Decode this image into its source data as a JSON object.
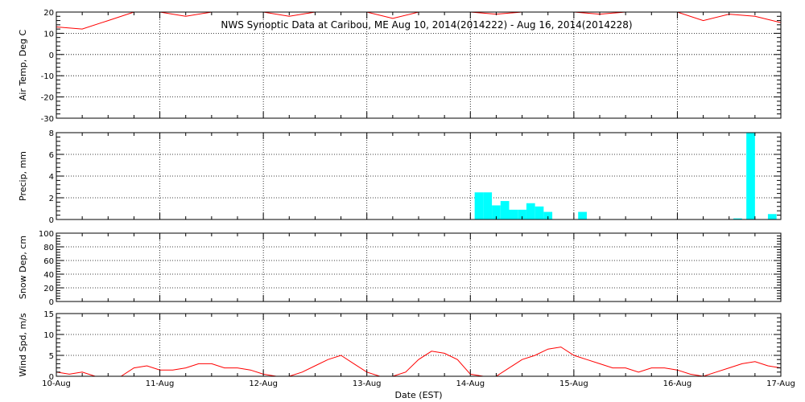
{
  "chart_data": [
    {
      "panel": "airtemp",
      "type": "line",
      "title": "NWS Synoptic Data at Caribou, ME   Aug 10, 2014(2014222) - Aug 16, 2014(2014228)",
      "ylabel": "Air Temp, Deg C",
      "ylim": [
        -30,
        20
      ],
      "yticks": [
        20,
        10,
        0,
        -10,
        -20,
        -30
      ],
      "x": [
        "2014-08-10T00:00",
        "2014-08-10T06:00",
        "2014-08-10T12:00",
        "2014-08-10T18:00",
        "2014-08-11T00:00",
        "2014-08-11T06:00",
        "2014-08-11T12:00",
        "2014-08-11T18:00",
        "2014-08-12T00:00",
        "2014-08-12T06:00",
        "2014-08-12T12:00",
        "2014-08-12T18:00",
        "2014-08-13T00:00",
        "2014-08-13T06:00",
        "2014-08-13T12:00",
        "2014-08-13T18:00",
        "2014-08-14T00:00",
        "2014-08-14T06:00",
        "2014-08-14T12:00",
        "2014-08-14T18:00",
        "2014-08-15T00:00",
        "2014-08-15T06:00",
        "2014-08-15T12:00",
        "2014-08-15T18:00",
        "2014-08-16T00:00",
        "2014-08-16T06:00",
        "2014-08-16T12:00",
        "2014-08-16T18:00",
        "2014-08-17T00:00"
      ],
      "values": [
        13,
        12,
        16,
        22,
        23,
        18,
        20,
        24,
        24,
        18,
        21,
        24,
        24,
        17,
        21,
        24,
        22,
        19,
        22,
        24,
        22,
        19,
        21,
        24,
        21,
        16,
        19,
        18,
        15
      ],
      "color": "#ff0000",
      "grid": true
    },
    {
      "panel": "precip",
      "type": "bar",
      "ylabel": "Precip, mm",
      "ylim": [
        0,
        8
      ],
      "yticks": [
        0,
        2,
        4,
        6,
        8
      ],
      "x": [
        "2014-08-14T02:00",
        "2014-08-14T04:00",
        "2014-08-14T06:00",
        "2014-08-14T08:00",
        "2014-08-14T10:00",
        "2014-08-14T12:00",
        "2014-08-14T14:00",
        "2014-08-14T16:00",
        "2014-08-14T18:00",
        "2014-08-14T20:00",
        "2014-08-15T02:00",
        "2014-08-16T14:00",
        "2014-08-16T17:00",
        "2014-08-16T22:00"
      ],
      "values": [
        2.5,
        2.5,
        1.3,
        1.7,
        0.9,
        0.9,
        1.5,
        1.2,
        0.7,
        0,
        0.7,
        0.1,
        8.5,
        0.5
      ],
      "color": "#00ffff",
      "grid": true
    },
    {
      "panel": "snowdep",
      "type": "line",
      "ylabel": "Snow Dep, cm",
      "ylim": [
        0,
        100
      ],
      "yticks": [
        0,
        20,
        40,
        60,
        80,
        100
      ],
      "x": [],
      "values": [],
      "grid": true
    },
    {
      "panel": "windspd",
      "type": "line",
      "ylabel": "Wind Spd, m/s",
      "xlabel": "Date (EST)",
      "ylim": [
        0,
        15
      ],
      "yticks": [
        0,
        5,
        10,
        15
      ],
      "xlim": [
        "2014-08-10",
        "2014-08-17"
      ],
      "xticks": [
        "10-Aug",
        "11-Aug",
        "12-Aug",
        "13-Aug",
        "14-Aug",
        "15-Aug",
        "16-Aug",
        "17-Aug"
      ],
      "x": [
        "2014-08-10T00:00",
        "2014-08-10T03:00",
        "2014-08-10T06:00",
        "2014-08-10T09:00",
        "2014-08-10T12:00",
        "2014-08-10T15:00",
        "2014-08-10T18:00",
        "2014-08-10T21:00",
        "2014-08-11T00:00",
        "2014-08-11T03:00",
        "2014-08-11T06:00",
        "2014-08-11T09:00",
        "2014-08-11T12:00",
        "2014-08-11T15:00",
        "2014-08-11T18:00",
        "2014-08-11T21:00",
        "2014-08-12T00:00",
        "2014-08-12T03:00",
        "2014-08-12T06:00",
        "2014-08-12T09:00",
        "2014-08-12T12:00",
        "2014-08-12T15:00",
        "2014-08-12T18:00",
        "2014-08-12T21:00",
        "2014-08-13T00:00",
        "2014-08-13T03:00",
        "2014-08-13T06:00",
        "2014-08-13T09:00",
        "2014-08-13T12:00",
        "2014-08-13T15:00",
        "2014-08-13T18:00",
        "2014-08-13T21:00",
        "2014-08-14T00:00",
        "2014-08-14T03:00",
        "2014-08-14T06:00",
        "2014-08-14T09:00",
        "2014-08-14T12:00",
        "2014-08-14T15:00",
        "2014-08-14T18:00",
        "2014-08-14T21:00",
        "2014-08-15T00:00",
        "2014-08-15T03:00",
        "2014-08-15T06:00",
        "2014-08-15T09:00",
        "2014-08-15T12:00",
        "2014-08-15T15:00",
        "2014-08-15T18:00",
        "2014-08-15T21:00",
        "2014-08-16T00:00",
        "2014-08-16T03:00",
        "2014-08-16T06:00",
        "2014-08-16T09:00",
        "2014-08-16T12:00",
        "2014-08-16T15:00",
        "2014-08-16T18:00",
        "2014-08-16T21:00",
        "2014-08-17T00:00"
      ],
      "values": [
        1,
        0.5,
        1,
        0,
        0,
        0,
        2,
        2.5,
        1.5,
        1.5,
        2,
        3,
        3,
        2,
        2,
        1.5,
        0.5,
        0,
        0,
        1,
        2.5,
        4,
        5,
        3,
        1,
        0,
        0,
        1,
        4,
        6,
        5.5,
        4,
        0.5,
        0,
        0,
        2,
        4,
        5,
        6.5,
        7,
        5,
        4,
        3,
        2,
        2,
        1,
        2,
        2,
        1.5,
        0.5,
        0,
        1,
        2,
        3,
        3.5,
        2.5,
        2
      ],
      "color": "#ff0000",
      "grid": true
    }
  ]
}
